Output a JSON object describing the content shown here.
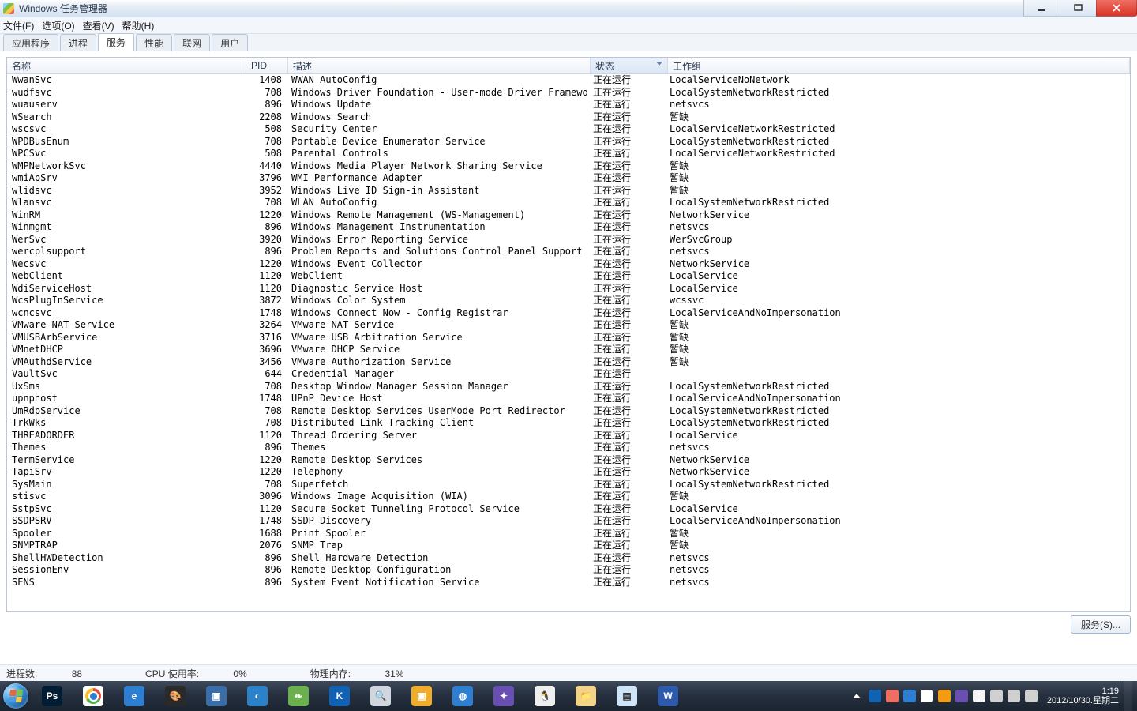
{
  "window": {
    "title": "Windows 任务管理器"
  },
  "menus": [
    "文件(F)",
    "选项(O)",
    "查看(V)",
    "帮助(H)"
  ],
  "tabs": {
    "items": [
      "应用程序",
      "进程",
      "服务",
      "性能",
      "联网",
      "用户"
    ],
    "active": 2
  },
  "columns": {
    "name": "名称",
    "pid": "PID",
    "desc": "描述",
    "status": "状态",
    "group": "工作组"
  },
  "button_services": "服务(S)...",
  "status": {
    "processes_label": "进程数:",
    "processes": "88",
    "cpu_label": "CPU 使用率:",
    "cpu": "0%",
    "mem_label": "物理内存:",
    "mem": "31%"
  },
  "clock": {
    "time": "1:19",
    "date": "2012/10/30.星期二"
  },
  "services": [
    {
      "name": "WwanSvc",
      "pid": "1408",
      "desc": "WWAN AutoConfig",
      "status": "正在运行",
      "group": "LocalServiceNoNetwork"
    },
    {
      "name": "wudfsvc",
      "pid": "708",
      "desc": "Windows Driver Foundation - User-mode Driver Framework",
      "status": "正在运行",
      "group": "LocalSystemNetworkRestricted"
    },
    {
      "name": "wuauserv",
      "pid": "896",
      "desc": "Windows Update",
      "status": "正在运行",
      "group": "netsvcs"
    },
    {
      "name": "WSearch",
      "pid": "2208",
      "desc": "Windows Search",
      "status": "正在运行",
      "group": "暂缺"
    },
    {
      "name": "wscsvc",
      "pid": "508",
      "desc": "Security Center",
      "status": "正在运行",
      "group": "LocalServiceNetworkRestricted"
    },
    {
      "name": "WPDBusEnum",
      "pid": "708",
      "desc": "Portable Device Enumerator Service",
      "status": "正在运行",
      "group": "LocalSystemNetworkRestricted"
    },
    {
      "name": "WPCSvc",
      "pid": "508",
      "desc": "Parental Controls",
      "status": "正在运行",
      "group": "LocalServiceNetworkRestricted"
    },
    {
      "name": "WMPNetworkSvc",
      "pid": "4440",
      "desc": "Windows Media Player Network Sharing Service",
      "status": "正在运行",
      "group": "暂缺"
    },
    {
      "name": "wmiApSrv",
      "pid": "3796",
      "desc": "WMI Performance Adapter",
      "status": "正在运行",
      "group": "暂缺"
    },
    {
      "name": "wlidsvc",
      "pid": "3952",
      "desc": "Windows Live ID Sign-in Assistant",
      "status": "正在运行",
      "group": "暂缺"
    },
    {
      "name": "Wlansvc",
      "pid": "708",
      "desc": "WLAN AutoConfig",
      "status": "正在运行",
      "group": "LocalSystemNetworkRestricted"
    },
    {
      "name": "WinRM",
      "pid": "1220",
      "desc": "Windows Remote Management (WS-Management)",
      "status": "正在运行",
      "group": "NetworkService"
    },
    {
      "name": "Winmgmt",
      "pid": "896",
      "desc": "Windows Management Instrumentation",
      "status": "正在运行",
      "group": "netsvcs"
    },
    {
      "name": "WerSvc",
      "pid": "3920",
      "desc": "Windows Error Reporting Service",
      "status": "正在运行",
      "group": "WerSvcGroup"
    },
    {
      "name": "wercplsupport",
      "pid": "896",
      "desc": "Problem Reports and Solutions Control Panel Support",
      "status": "正在运行",
      "group": "netsvcs"
    },
    {
      "name": "Wecsvc",
      "pid": "1220",
      "desc": "Windows Event Collector",
      "status": "正在运行",
      "group": "NetworkService"
    },
    {
      "name": "WebClient",
      "pid": "1120",
      "desc": "WebClient",
      "status": "正在运行",
      "group": "LocalService"
    },
    {
      "name": "WdiServiceHost",
      "pid": "1120",
      "desc": "Diagnostic Service Host",
      "status": "正在运行",
      "group": "LocalService"
    },
    {
      "name": "WcsPlugInService",
      "pid": "3872",
      "desc": "Windows Color System",
      "status": "正在运行",
      "group": "wcssvc"
    },
    {
      "name": "wcncsvc",
      "pid": "1748",
      "desc": "Windows Connect Now - Config Registrar",
      "status": "正在运行",
      "group": "LocalServiceAndNoImpersonation"
    },
    {
      "name": "VMware NAT Service",
      "pid": "3264",
      "desc": "VMware NAT Service",
      "status": "正在运行",
      "group": "暂缺"
    },
    {
      "name": "VMUSBArbService",
      "pid": "3716",
      "desc": "VMware USB Arbitration Service",
      "status": "正在运行",
      "group": "暂缺"
    },
    {
      "name": "VMnetDHCP",
      "pid": "3696",
      "desc": "VMware DHCP Service",
      "status": "正在运行",
      "group": "暂缺"
    },
    {
      "name": "VMAuthdService",
      "pid": "3456",
      "desc": "VMware Authorization Service",
      "status": "正在运行",
      "group": "暂缺"
    },
    {
      "name": "VaultSvc",
      "pid": "644",
      "desc": "Credential Manager",
      "status": "正在运行",
      "group": ""
    },
    {
      "name": "UxSms",
      "pid": "708",
      "desc": "Desktop Window Manager Session Manager",
      "status": "正在运行",
      "group": "LocalSystemNetworkRestricted"
    },
    {
      "name": "upnphost",
      "pid": "1748",
      "desc": "UPnP Device Host",
      "status": "正在运行",
      "group": "LocalServiceAndNoImpersonation"
    },
    {
      "name": "UmRdpService",
      "pid": "708",
      "desc": "Remote Desktop Services UserMode Port Redirector",
      "status": "正在运行",
      "group": "LocalSystemNetworkRestricted"
    },
    {
      "name": "TrkWks",
      "pid": "708",
      "desc": "Distributed Link Tracking Client",
      "status": "正在运行",
      "group": "LocalSystemNetworkRestricted"
    },
    {
      "name": "THREADORDER",
      "pid": "1120",
      "desc": "Thread Ordering Server",
      "status": "正在运行",
      "group": "LocalService"
    },
    {
      "name": "Themes",
      "pid": "896",
      "desc": "Themes",
      "status": "正在运行",
      "group": "netsvcs"
    },
    {
      "name": "TermService",
      "pid": "1220",
      "desc": "Remote Desktop Services",
      "status": "正在运行",
      "group": "NetworkService"
    },
    {
      "name": "TapiSrv",
      "pid": "1220",
      "desc": "Telephony",
      "status": "正在运行",
      "group": "NetworkService"
    },
    {
      "name": "SysMain",
      "pid": "708",
      "desc": "Superfetch",
      "status": "正在运行",
      "group": "LocalSystemNetworkRestricted"
    },
    {
      "name": "stisvc",
      "pid": "3096",
      "desc": "Windows Image Acquisition (WIA)",
      "status": "正在运行",
      "group": "暂缺"
    },
    {
      "name": "SstpSvc",
      "pid": "1120",
      "desc": "Secure Socket Tunneling Protocol Service",
      "status": "正在运行",
      "group": "LocalService"
    },
    {
      "name": "SSDPSRV",
      "pid": "1748",
      "desc": "SSDP Discovery",
      "status": "正在运行",
      "group": "LocalServiceAndNoImpersonation"
    },
    {
      "name": "Spooler",
      "pid": "1688",
      "desc": "Print Spooler",
      "status": "正在运行",
      "group": "暂缺"
    },
    {
      "name": "SNMPTRAP",
      "pid": "2076",
      "desc": "SNMP Trap",
      "status": "正在运行",
      "group": "暂缺"
    },
    {
      "name": "ShellHWDetection",
      "pid": "896",
      "desc": "Shell Hardware Detection",
      "status": "正在运行",
      "group": "netsvcs"
    },
    {
      "name": "SessionEnv",
      "pid": "896",
      "desc": "Remote Desktop Configuration",
      "status": "正在运行",
      "group": "netsvcs"
    },
    {
      "name": "SENS",
      "pid": "896",
      "desc": "System Event Notification Service",
      "status": "正在运行",
      "group": "netsvcs"
    }
  ],
  "taskbar_icons": [
    {
      "name": "photoshop-icon",
      "bg": "#001d33",
      "txt": "Ps"
    },
    {
      "name": "chrome-icon",
      "bg": "#ffffff",
      "txt": ""
    },
    {
      "name": "ie-icon",
      "bg": "#2e7fd1",
      "txt": "e"
    },
    {
      "name": "palette-icon",
      "bg": "#2a2a2a",
      "txt": "🎨"
    },
    {
      "name": "vm-icon",
      "bg": "#3a6ea8",
      "txt": "▣"
    },
    {
      "name": "circle-icon",
      "bg": "#2c82c9",
      "txt": "◐"
    },
    {
      "name": "leaf-icon",
      "bg": "#6ab04c",
      "txt": "❧"
    },
    {
      "name": "kugou-icon",
      "bg": "#1262b3",
      "txt": "K"
    },
    {
      "name": "magnifier-icon",
      "bg": "#cfd6e0",
      "txt": "🔍"
    },
    {
      "name": "shield-icon",
      "bg": "#f0ad2a",
      "txt": "▣"
    },
    {
      "name": "globe-icon",
      "bg": "#2e7fd1",
      "txt": "◍"
    },
    {
      "name": "bird-icon",
      "bg": "#6a4fb3",
      "txt": "✦"
    },
    {
      "name": "qq-icon",
      "bg": "#eeeeee",
      "txt": "🐧"
    },
    {
      "name": "explorer-icon",
      "bg": "#f2d488",
      "txt": "📁"
    },
    {
      "name": "taskmgr-icon",
      "bg": "#cfe4f7",
      "txt": "▤"
    },
    {
      "name": "word-icon",
      "bg": "#2e5aac",
      "txt": "W"
    }
  ],
  "tray_icons": [
    {
      "name": "tray-1",
      "bg": "#1262b3"
    },
    {
      "name": "tray-2",
      "bg": "#ef6e62"
    },
    {
      "name": "tray-3",
      "bg": "#2e7fd1"
    },
    {
      "name": "tray-4",
      "bg": "#ffffff"
    },
    {
      "name": "tray-5",
      "bg": "#f39c12"
    },
    {
      "name": "tray-6",
      "bg": "#6a4fb3"
    },
    {
      "name": "tray-input",
      "bg": "#f5f5f5"
    },
    {
      "name": "tray-flag",
      "bg": "#d0d0d0"
    },
    {
      "name": "tray-net",
      "bg": "#d0d0d0"
    },
    {
      "name": "tray-vol",
      "bg": "#d0d0d0"
    }
  ]
}
